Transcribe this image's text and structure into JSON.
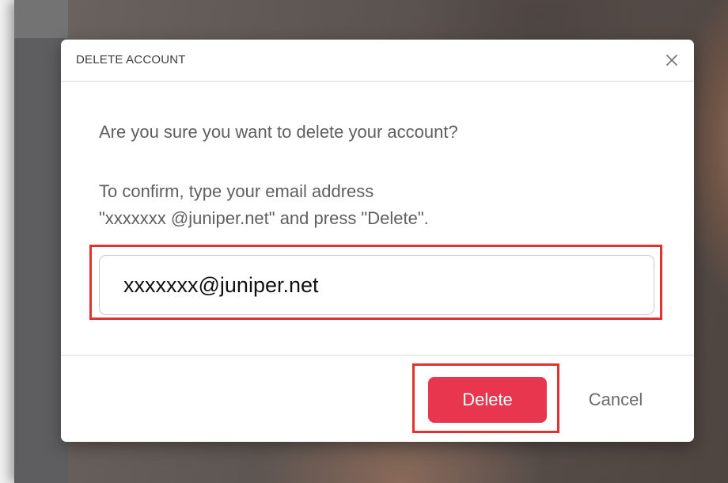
{
  "dialog": {
    "title": "DELETE ACCOUNT",
    "question": "Are you sure you want to delete your account?",
    "instruction_line1": "To confirm, type your email address",
    "instruction_line2": "\"xxxxxxx @juniper.net\" and press \"Delete\".",
    "email_value": "xxxxxxx@juniper.net",
    "delete_label": "Delete",
    "cancel_label": "Cancel"
  },
  "icons": {
    "close": "close-icon"
  },
  "colors": {
    "delete_button": "#e8364f",
    "highlight_box": "#e0322f",
    "body_text": "#5f5f5f"
  }
}
